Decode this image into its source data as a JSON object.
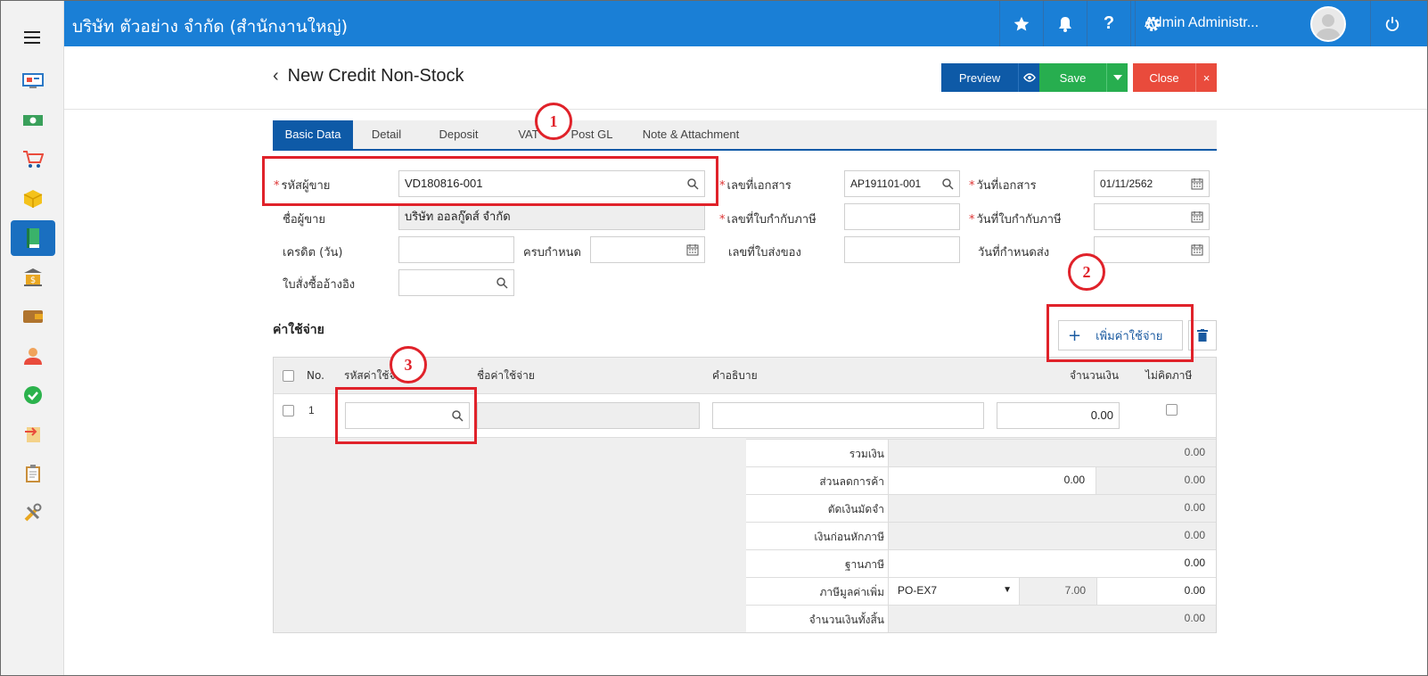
{
  "topbar": {
    "company": "บริษัท ตัวอย่าง จำกัด (สำนักงานใหญ่)",
    "user": "Admin Administr...",
    "icons": [
      "star-icon",
      "bell-icon",
      "help-icon",
      "gear-icon",
      "avatar",
      "power-icon"
    ],
    "color": "#1a7fd6"
  },
  "sidebar": {
    "items": [
      "dashboard-icon",
      "money-icon",
      "cart-icon",
      "box-icon",
      "book-icon",
      "bank-icon",
      "wallet-icon",
      "users-icon",
      "approve-icon",
      "transfer-icon",
      "clipboard-icon",
      "tools-icon"
    ],
    "active_index": 4
  },
  "page": {
    "title": "New Credit Non-Stock",
    "buttons": {
      "preview": "Preview",
      "save": "Save",
      "close": "Close"
    }
  },
  "tabs": [
    "Basic Data",
    "Detail",
    "Deposit",
    "VAT",
    "Post GL",
    "Note & Attachment"
  ],
  "form": {
    "vendor_code_label": "รหัสผู้ขาย",
    "vendor_code_value": "VD180816-001",
    "vendor_name_label": "ชื่อผู้ขาย",
    "vendor_name_value": "บริษัท ออลกู๊ดส์ จำกัด",
    "credit_label": "เครดิต (วัน)",
    "credit_value": "",
    "due_label": "ครบกำหนด",
    "due_value": "",
    "po_ref_label": "ใบสั่งซื้ออ้างอิง",
    "po_ref_value": "",
    "doc_no_label": "เลขที่เอกสาร",
    "doc_no_value": "AP191101-001",
    "tax_inv_no_label": "เลขที่ใบกำกับภาษี",
    "tax_inv_no_value": "",
    "delivery_no_label": "เลขที่ใบส่งของ",
    "delivery_no_value": "",
    "doc_date_label": "วันที่เอกสาร",
    "doc_date_value": "01/11/2562",
    "tax_inv_date_label": "วันที่ใบกำกับภาษี",
    "tax_inv_date_value": "",
    "delivery_date_label": "วันที่กำหนดส่ง",
    "delivery_date_value": ""
  },
  "expenses": {
    "section_title": "ค่าใช้จ่าย",
    "add_button": "เพิ่มค่าใช้จ่าย",
    "columns": [
      "No.",
      "รหัสค่าใช้จ่าย",
      "ชื่อค่าใช้จ่าย",
      "คำอธิบาย",
      "จำนวนเงิน",
      "ไม่คิดภาษี"
    ],
    "rows": [
      {
        "no": "1",
        "code": "",
        "name": "",
        "description": "",
        "amount": "0.00"
      }
    ]
  },
  "summary": {
    "total_label": "รวมเงิน",
    "total": "0.00",
    "discount_label": "ส่วนลดการค้า",
    "discount_input": "0.00",
    "discount": "0.00",
    "deposit_label": "ตัดเงินมัดจำ",
    "deposit": "0.00",
    "pretax_label": "เงินก่อนหักภาษี",
    "pretax": "0.00",
    "tax_base_label": "ฐานภาษี",
    "tax_base": "0.00",
    "vat_label": "ภาษีมูลค่าเพิ่ม",
    "vat_code": "PO-EX7",
    "vat_rate": "7.00",
    "vat": "0.00",
    "grand_total_label": "จำนวนเงินทั้งสิ้น",
    "grand_total": "0.00"
  },
  "annotations": {
    "one": "1",
    "two": "2",
    "three": "3"
  }
}
